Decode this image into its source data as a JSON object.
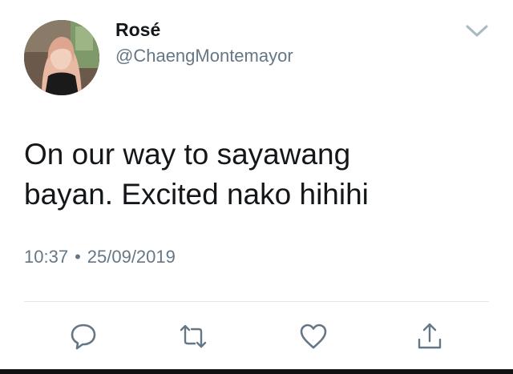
{
  "user": {
    "display_name": "Rosé",
    "handle": "@ChaengMontemayor"
  },
  "tweet": {
    "text_line1": "On our way to sayawang",
    "text_line2": "bayan. Excited nako hihihi",
    "time": "10:37",
    "separator": "•",
    "date": "25/09/2019"
  },
  "actions": {
    "icons": [
      "reply-icon",
      "retweet-icon",
      "like-icon",
      "share-icon"
    ]
  },
  "colors": {
    "text": "#14171a",
    "secondary": "#657786",
    "divider": "#e1e8ed"
  }
}
